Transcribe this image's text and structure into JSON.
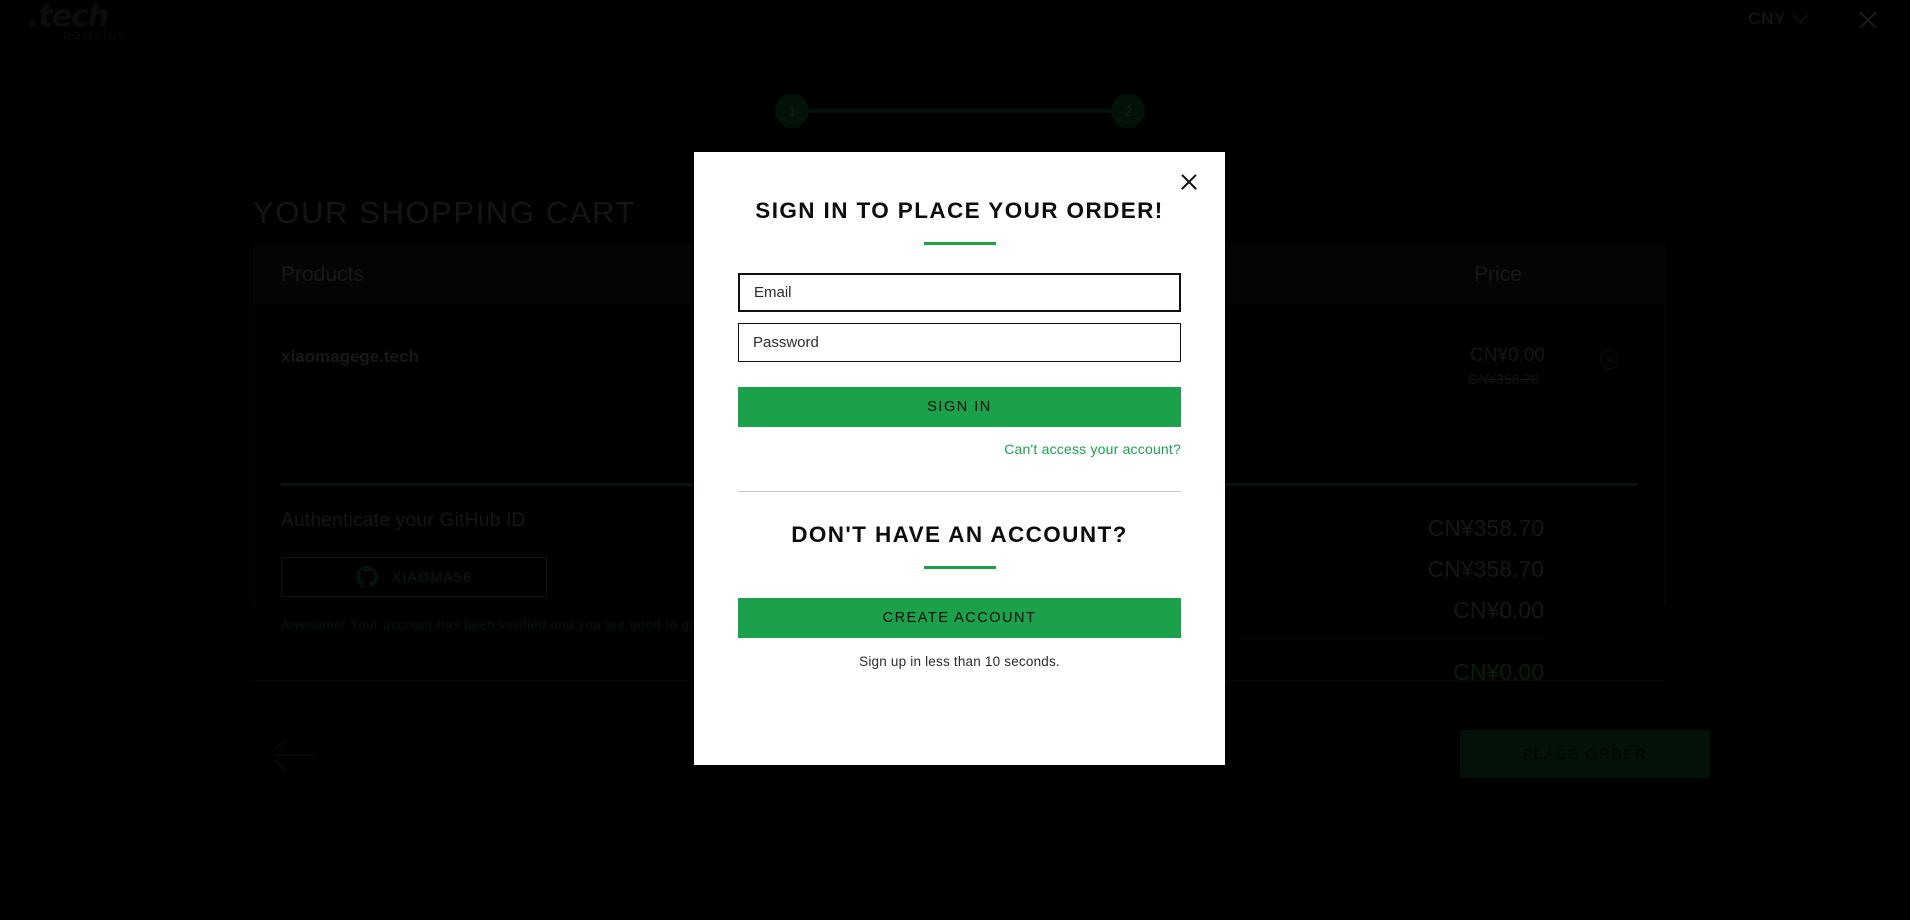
{
  "topbar": {
    "logo_main": ".tech",
    "logo_dot": ".",
    "logo_word": "tech",
    "logo_sub": "DOMAINS",
    "currency": "CNY",
    "close_label": "×"
  },
  "stepper": {
    "step1": "1",
    "step2": "2"
  },
  "cart": {
    "heading": "YOUR SHOPPING CART",
    "columns": {
      "products": "Products",
      "price": "Price"
    },
    "product": {
      "name": "xiaomagege.tech",
      "price": "CN¥0.00",
      "price_original": "CN¥358.70"
    },
    "github": {
      "title": "Authenticate your GitHub ID",
      "username": "XIAOMA56",
      "note": "Awesome! Your account has been verified and you are good to go!"
    },
    "summary": [
      "CN¥358.70",
      "CN¥358.70",
      "CN¥0.00"
    ],
    "total": "CN¥0.00"
  },
  "footer": {
    "place_order": "PLACE ORDER"
  },
  "modal": {
    "title": "SIGN IN TO PLACE YOUR ORDER!",
    "email_placeholder": "Email",
    "email_value": "",
    "password_placeholder": "Password",
    "password_value": "",
    "signin_label": "SIGN IN",
    "help_link": "Can't access your account?",
    "signup_title": "DON'T HAVE AN ACCOUNT?",
    "create_label": "CREATE ACCOUNT",
    "signup_note": "Sign up in less than 10 seconds.",
    "close_label": "×"
  },
  "colors": {
    "accent_green": "#1aa14a",
    "page_bg": "#000000",
    "modal_bg": "#ffffff"
  }
}
